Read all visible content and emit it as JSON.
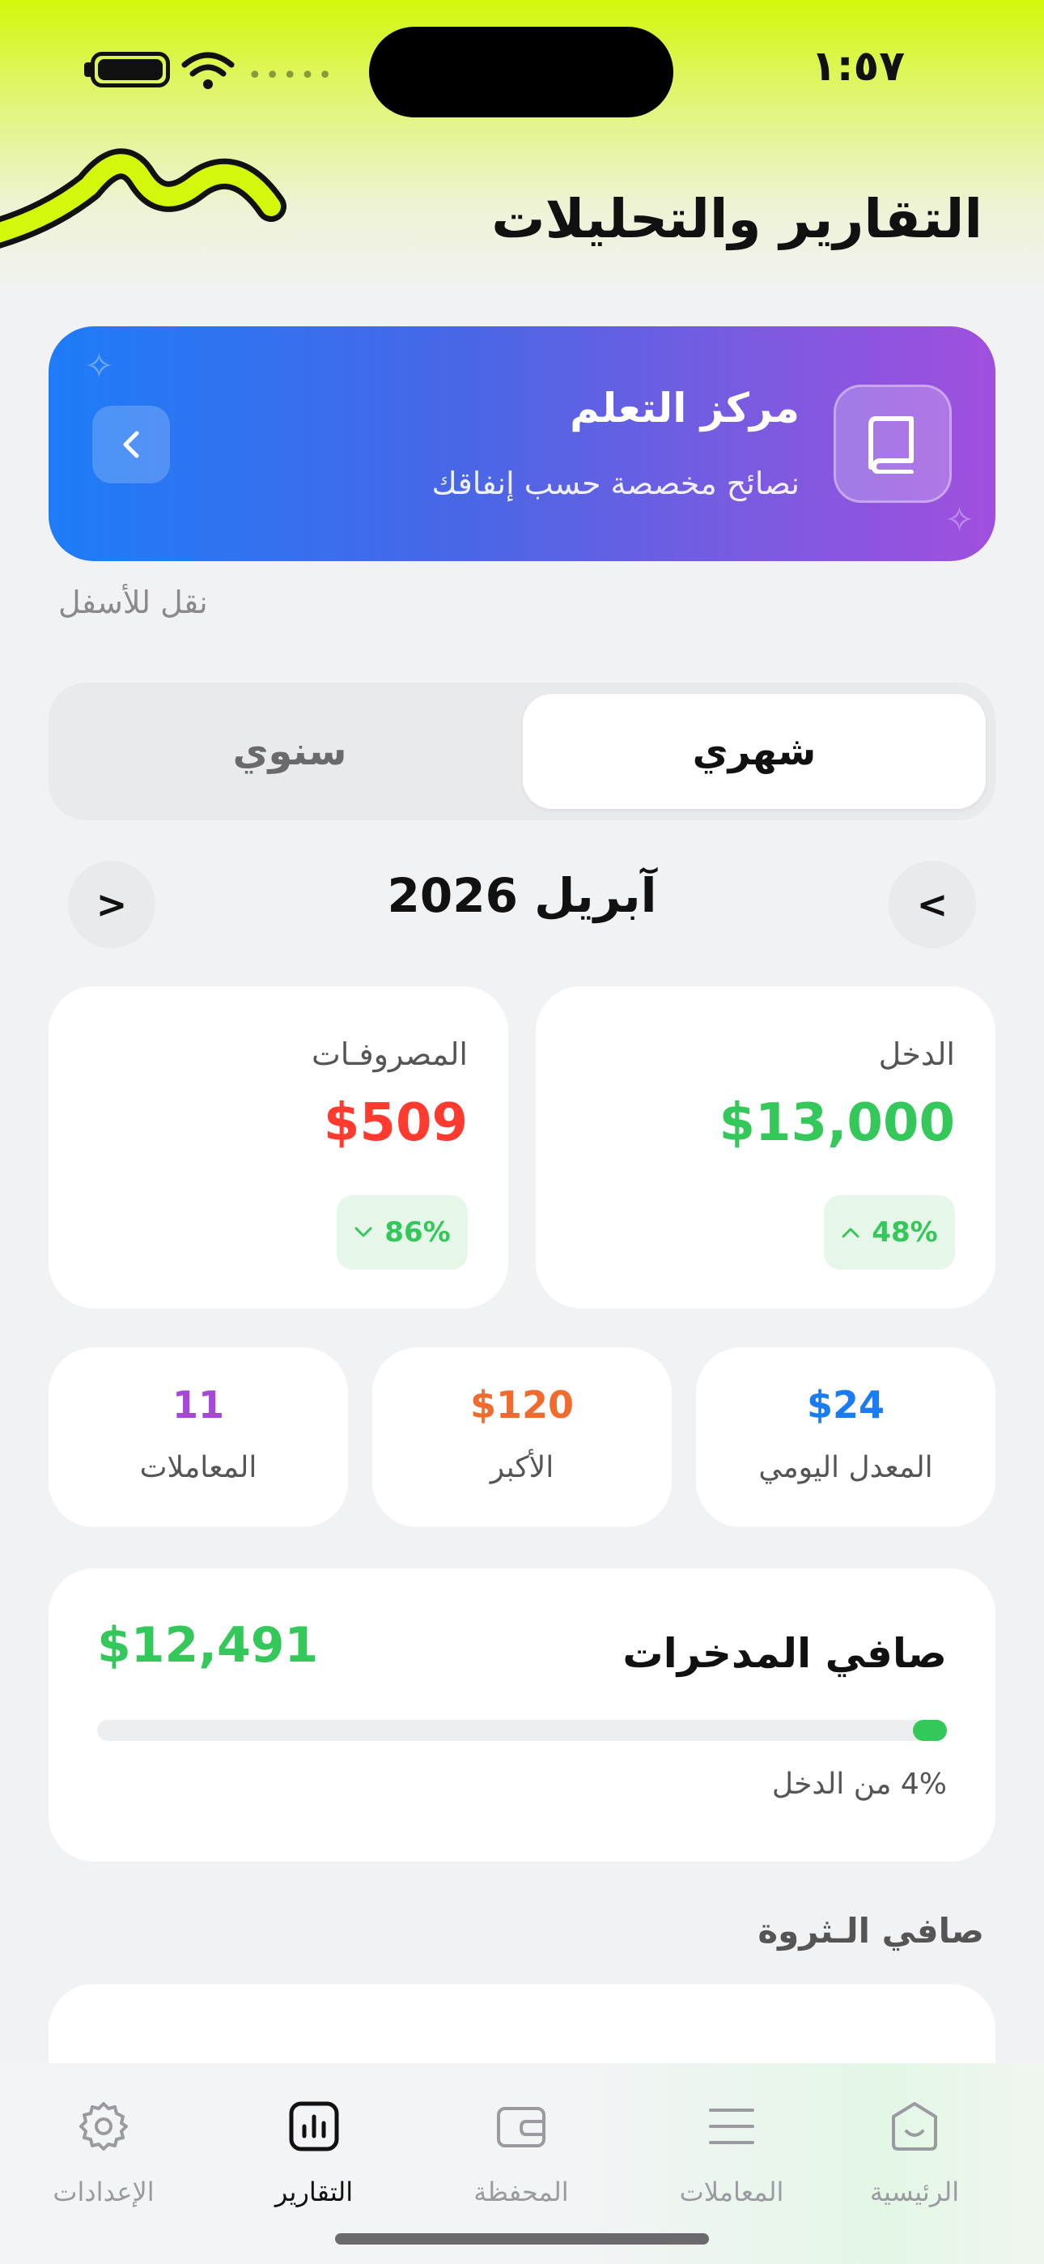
{
  "status_bar": {
    "time": "١:٥٧"
  },
  "header": {
    "title": "التقارير والتحليلات"
  },
  "learning_card": {
    "title": "مركز التعلم",
    "subtitle": "نصائح مخصصة حسب إنفاقك",
    "icon": "book-icon"
  },
  "move_down_label": "نقل للأسفل",
  "period_toggle": {
    "monthly": "شهري",
    "yearly": "سنوي",
    "selected": "monthly"
  },
  "month_nav": {
    "label": "آبريل 2026",
    "prev": "<",
    "next": ">"
  },
  "income": {
    "label": "الدخل",
    "value": "$13,000",
    "change": "48%",
    "direction": "up",
    "color": "#34c759"
  },
  "expenses": {
    "label": "المصروفـات",
    "value": "$509",
    "change": "86%",
    "direction": "down",
    "color": "#ff3b30"
  },
  "stats": [
    {
      "label": "المعدل اليومي",
      "value": "$24",
      "color": "#1a7cf5"
    },
    {
      "label": "الأكبر",
      "value": "$120",
      "color": "#f26b2e"
    },
    {
      "label": "المعاملات",
      "value": "11",
      "color": "#a548d6"
    }
  ],
  "net_savings": {
    "title": "صافي المدخرات",
    "value": "$12,491",
    "subtitle": "4% من الدخل",
    "progress_percent": 4
  },
  "net_worth": {
    "label": "صافي الـثروة"
  },
  "tabbar": [
    {
      "label": "الرئيسية",
      "icon": "home-icon",
      "active": false
    },
    {
      "label": "المعاملات",
      "icon": "list-icon",
      "active": false
    },
    {
      "label": "المحفظة",
      "icon": "wallet-icon",
      "active": false
    },
    {
      "label": "التقارير",
      "icon": "chart-icon",
      "active": true
    },
    {
      "label": "الإعدادات",
      "icon": "gear-icon",
      "active": false
    }
  ]
}
